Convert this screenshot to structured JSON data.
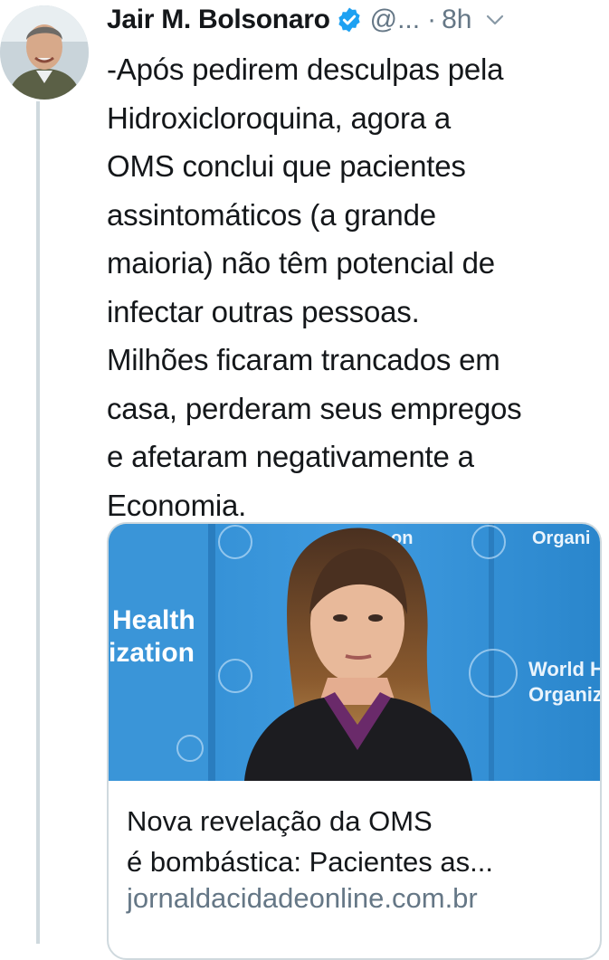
{
  "tweet": {
    "author_name": "Jair M. Bolsonaro",
    "handle": "@...",
    "separator": "·",
    "time": "8h",
    "text_lines": [
      "-Após pedirem desculpas pela",
      "Hidroxicloroquina, agora a",
      "OMS conclui que pacientes",
      "assintomáticos (a grande",
      "maioria) não têm potencial de",
      "infectar outras pessoas.",
      "Milhões ficaram trancados em",
      "casa, perderam seus empregos",
      "e afetaram negativamente a",
      "Economia."
    ],
    "card": {
      "title_lines": [
        "Nova revelação da OMS",
        "é bombástica: Pacientes as..."
      ],
      "domain": "jornaldacidadeonline.com.br",
      "image": {
        "backdrop_left_text_1": "Health",
        "backdrop_left_text_2": "ization",
        "backdrop_top_text_1": "on",
        "backdrop_top_text_2": "Organi",
        "backdrop_right_text_1": "World H",
        "backdrop_right_text_2": "Organiz"
      }
    }
  },
  "colors": {
    "text": "#14171a",
    "secondary": "#657786",
    "verified": "#1da1f2",
    "border": "#cfd9de",
    "who_blue": "#2e8fd2"
  }
}
